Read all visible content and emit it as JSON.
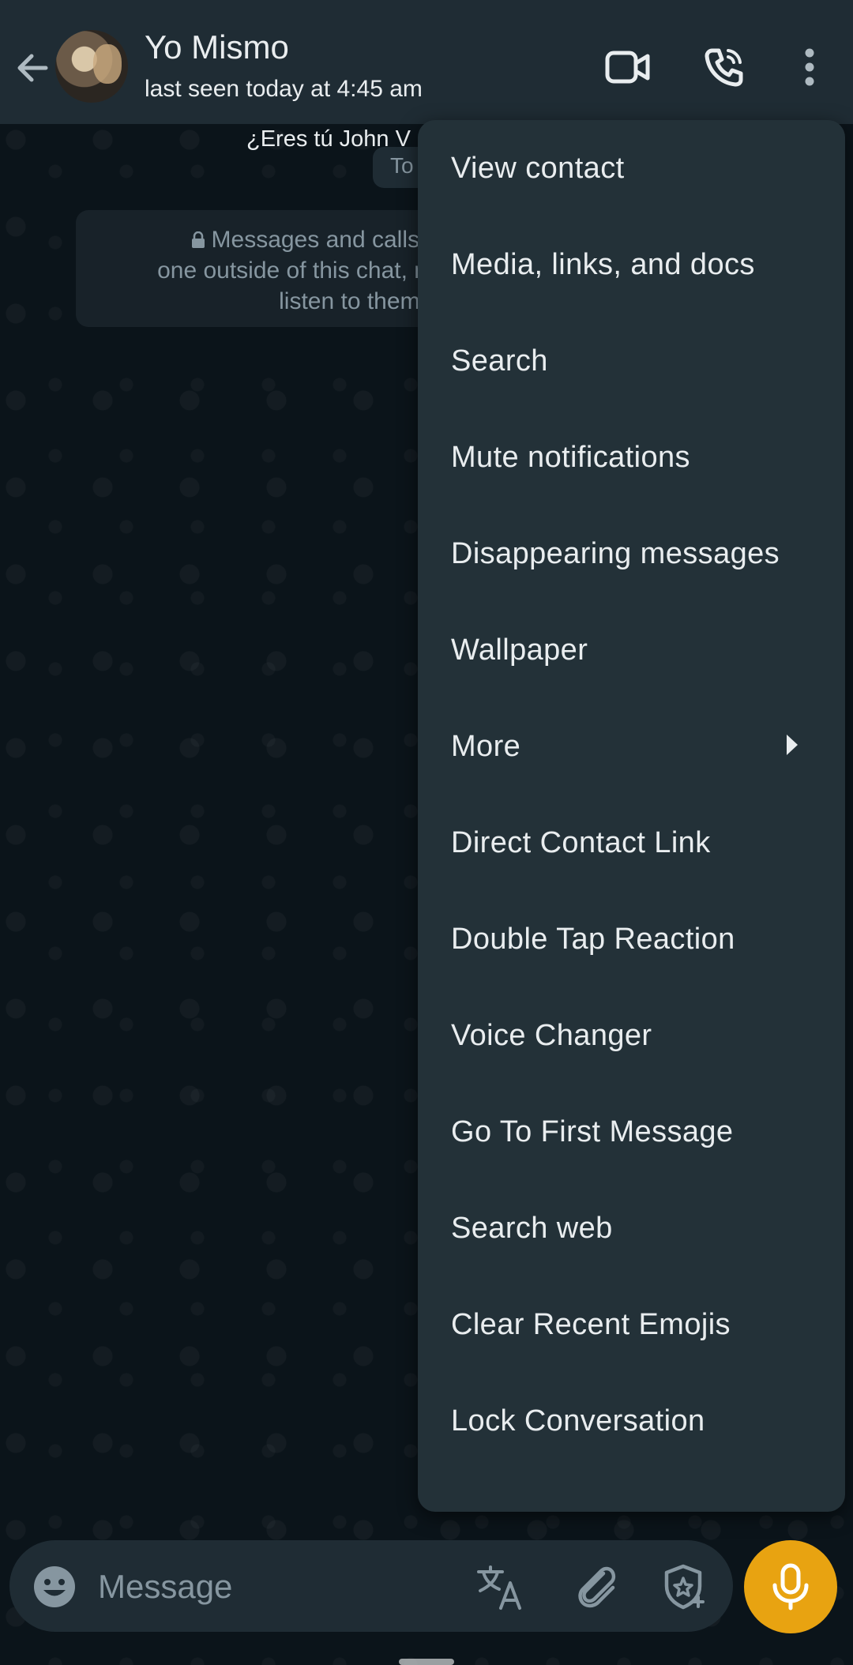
{
  "header": {
    "contact_name": "Yo Mismo",
    "last_seen": "last seen today at 4:45 am",
    "icons": [
      "back-arrow-icon",
      "video-call-icon",
      "voice-call-icon",
      "more-vert-icon"
    ]
  },
  "chat": {
    "encryption_title": "¿Eres tú John V",
    "date_chip": "To",
    "system_message_lines": [
      "Messages and calls ar",
      "one outside of this chat, not",
      "listen to them. T"
    ]
  },
  "menu": {
    "items": [
      "View contact",
      "Media, links, and docs",
      "Search",
      "Mute notifications",
      "Disappearing messages",
      "Wallpaper",
      "More",
      "Direct Contact Link",
      "Double Tap Reaction",
      "Voice Changer",
      "Go To First Message",
      "Search web",
      "Clear Recent Emojis",
      "Lock Conversation"
    ]
  },
  "composer": {
    "placeholder": "Message",
    "icons": [
      "emoji-icon",
      "translate-icon",
      "attach-icon",
      "ai-sticker-icon",
      "mic-icon"
    ]
  },
  "colors": {
    "header_bg": "#1f2c34",
    "chat_bg": "#0b141a",
    "menu_bg": "#233138",
    "mic_accent": "#e8a311"
  }
}
